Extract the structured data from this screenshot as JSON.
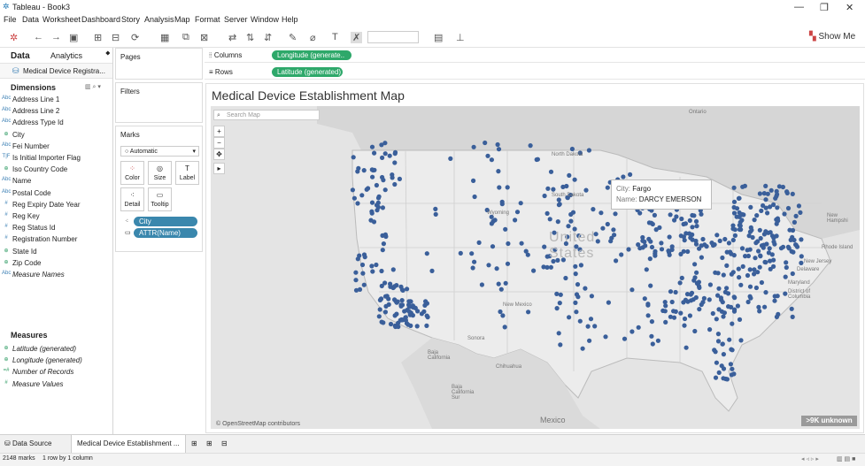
{
  "app": {
    "title": "Tableau - Book3",
    "icon": "tableau-logo-icon"
  },
  "window_controls": {
    "minimize": "—",
    "restore": "❐",
    "close": "✕"
  },
  "menu": [
    "File",
    "Data",
    "Worksheet",
    "Dashboard",
    "Story",
    "Analysis",
    "Map",
    "Format",
    "Server",
    "Window",
    "Help"
  ],
  "toolbar": {
    "show_me": "Show Me"
  },
  "left_panel": {
    "tab_data": "Data",
    "tab_analytics": "Analytics",
    "datasource": "Medical Device Registra...",
    "dimensions_title": "Dimensions",
    "dimensions": [
      {
        "label": "Address Line 1",
        "icon": "Abc"
      },
      {
        "label": "Address Line 2",
        "icon": "Abc"
      },
      {
        "label": "Address Type Id",
        "icon": "Abc"
      },
      {
        "label": "City",
        "icon": "⊕"
      },
      {
        "label": "Fei Number",
        "icon": "Abc"
      },
      {
        "label": "Is Initial Importer Flag",
        "icon": "T|F"
      },
      {
        "label": "Iso Country Code",
        "icon": "⊕"
      },
      {
        "label": "Name",
        "icon": "Abc"
      },
      {
        "label": "Postal Code",
        "icon": "Abc"
      },
      {
        "label": "Reg Expiry Date Year",
        "icon": "#"
      },
      {
        "label": "Reg Key",
        "icon": "#"
      },
      {
        "label": "Reg Status Id",
        "icon": "#"
      },
      {
        "label": "Registration Number",
        "icon": "#"
      },
      {
        "label": "State Id",
        "icon": "⊕"
      },
      {
        "label": "Zip Code",
        "icon": "⊕"
      },
      {
        "label": "Measure Names",
        "icon": "Abc"
      }
    ],
    "measures_title": "Measures",
    "measures": [
      {
        "label": "Latitude (generated)",
        "icon": "⊕"
      },
      {
        "label": "Longitude (generated)",
        "icon": "⊕"
      },
      {
        "label": "Number of Records",
        "icon": "=#"
      },
      {
        "label": "Measure Values",
        "icon": "#"
      }
    ]
  },
  "cards": {
    "pages": "Pages",
    "filters": "Filters",
    "marks": "Marks",
    "mark_type": "Automatic",
    "buttons": [
      "Color",
      "Size",
      "Label",
      "Detail",
      "Tooltip"
    ],
    "mark_pills": [
      "City",
      "ATTR(Name)"
    ]
  },
  "shelves": {
    "columns_label": "Columns",
    "columns_pill": "Longitude (generate..",
    "rows_label": "Rows",
    "rows_pill": "Latitude (generated)"
  },
  "viz": {
    "title": "Medical Device Establishment Map",
    "search_placeholder": "Search Map",
    "tooltip": {
      "city_key": "City:",
      "city_value": "Fargo",
      "name_key": "Name:",
      "name_value": "DARCY EMERSON"
    },
    "attribution": "© OpenStreetMap contributors",
    "unknown_badge": ">9K unknown",
    "labels": {
      "country": "United",
      "country2": "States",
      "ontario": "Ontario",
      "north_dakota": "North Dakota",
      "south_dakota": "South Dakota",
      "wyoming": "Wyoming",
      "new_mexico": "New Mexico",
      "new_jersey": "New Jersey",
      "delaware": "Delaware",
      "maryland": "Maryland",
      "district": "District of Columbia",
      "rhode": "Rhode Island",
      "new_hamp": "New Hampshi",
      "mexico": "Mexico",
      "baja": "Baja California",
      "chihuahua": "Chihuahua",
      "baja_sur": "Baja California Sur",
      "sonora": "Sonora"
    },
    "mark_color": "#3a5f9a"
  },
  "bottom": {
    "tabs": [
      "Data Source",
      "Medical Device Establishment ..."
    ]
  },
  "status": {
    "marks": "2148 marks",
    "dims": "1 row by 1 column"
  }
}
